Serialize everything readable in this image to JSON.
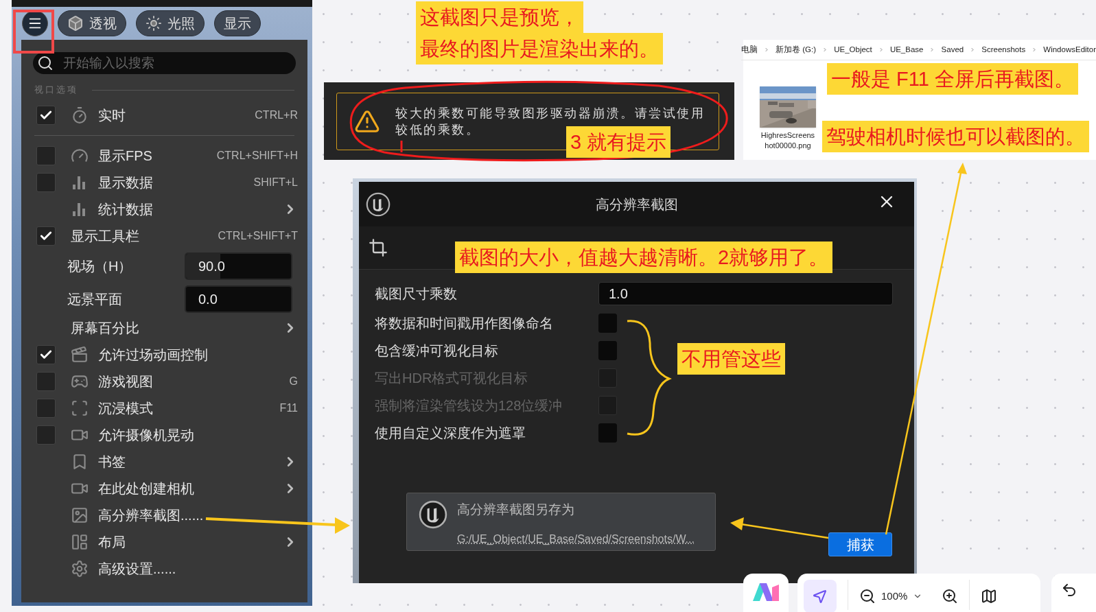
{
  "menu": {
    "toolbar_buttons": [
      {
        "label": "透视"
      },
      {
        "label": "光照"
      },
      {
        "label": "显示"
      }
    ],
    "search": {
      "placeholder": "开始输入以搜索"
    },
    "section_title": "视口选项",
    "items": [
      {
        "kind": "check",
        "label": "实时",
        "checked": true,
        "shortcut": "CTRL+R"
      },
      {
        "kind": "check",
        "label": "显示FPS",
        "checked": false,
        "shortcut": "CTRL+SHIFT+H"
      },
      {
        "kind": "check",
        "label": "显示数据",
        "checked": false,
        "shortcut": "SHIFT+L"
      },
      {
        "kind": "submenu",
        "label": "统计数据"
      },
      {
        "kind": "check",
        "label": "显示工具栏",
        "checked": true,
        "shortcut": "CTRL+SHIFT+T"
      },
      {
        "kind": "field",
        "label": "视场（H）",
        "value": "90.0",
        "level": 0.33
      },
      {
        "kind": "field",
        "label": "远景平面",
        "value": "0.0"
      },
      {
        "kind": "submenu",
        "label": "屏幕百分比"
      },
      {
        "kind": "check",
        "label": "允许过场动画控制",
        "checked": true
      },
      {
        "kind": "check",
        "label": "游戏视图",
        "checked": false,
        "shortcut": "G"
      },
      {
        "kind": "check",
        "label": "沉浸模式",
        "checked": false,
        "shortcut": "F11"
      },
      {
        "kind": "check",
        "label": "允许摄像机晃动",
        "checked": false
      },
      {
        "kind": "submenu",
        "label": "书签"
      },
      {
        "kind": "submenu",
        "label": "在此处创建相机"
      },
      {
        "kind": "action",
        "label": "高分辨率截图......"
      },
      {
        "kind": "submenu",
        "label": "布局"
      },
      {
        "kind": "action",
        "label": "高级设置......"
      }
    ]
  },
  "warning": {
    "text": "较大的乘数可能导致图形驱动器崩溃。请尝试使用较低的乘数。"
  },
  "explorer": {
    "breadcrumb": [
      "电脑",
      "新加卷 (G:)",
      "UE_Object",
      "UE_Base",
      "Saved",
      "Screenshots",
      "WindowsEditor"
    ],
    "file": {
      "name": "HighresScreenshot00000.png"
    }
  },
  "dialog": {
    "title": "高分辨率截图",
    "multiplier": {
      "label": "截图尺寸乘数",
      "value": "1.0"
    },
    "options": [
      {
        "label": "将数据和时间戳用作图像命名",
        "checked": false,
        "disabled": false
      },
      {
        "label": "包含缓冲可视化目标",
        "checked": false,
        "disabled": false
      },
      {
        "label": "写出HDR格式可视化目标",
        "checked": false,
        "disabled": true
      },
      {
        "label": "强制将渲染管线设为128位缓冲",
        "checked": false,
        "disabled": true
      },
      {
        "label": "使用自定义深度作为遮罩",
        "checked": false,
        "disabled": false
      }
    ],
    "toast": {
      "title": "高分辨率截图另存为",
      "path": "G:/UE_Object/UE_Base/Saved/Screenshots/W..."
    },
    "capture_button": "捕获"
  },
  "annotations": [
    {
      "lines": [
        "这截图只是预览，",
        "最终的图片是渲染出来的。"
      ]
    },
    {
      "lines": [
        "3 就有提示"
      ]
    },
    {
      "lines": [
        "截图的大小，值越大越清晰。2就够用了。"
      ]
    },
    {
      "lines": [
        "不用管这些"
      ]
    },
    {
      "lines": [
        "一般是 F11 全屏后再截图。"
      ]
    },
    {
      "lines": [
        "驾驶相机时候也可以截图的。"
      ]
    }
  ],
  "bottom_toolbar": {
    "pointer_tool": {
      "selected": true
    },
    "zoom": "100%"
  }
}
